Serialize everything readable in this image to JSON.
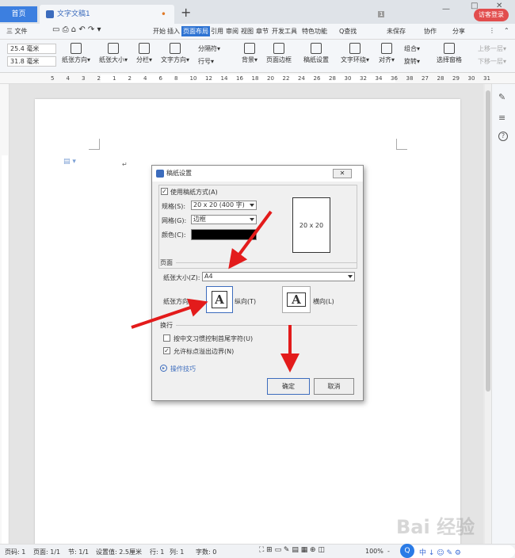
{
  "tabs": {
    "home": "首页",
    "doc": "文字文稿1",
    "doc_dot": "•",
    "new": "+"
  },
  "window": {
    "page_num": "1",
    "visitor": "访客登录",
    "min": "—",
    "max": "□",
    "close": "✕"
  },
  "menu": {
    "file": "三 文件",
    "items": [
      "开始",
      "插入",
      "页面布局",
      "引用",
      "审阅",
      "视图",
      "章节",
      "开发工具",
      "特色功能"
    ],
    "active": "页面布局",
    "search": "Q查找",
    "unsaved": "未保存",
    "coop": "协作",
    "share": "分享"
  },
  "ribbon": {
    "margin_top": "25.4 毫米",
    "margin_bottom": "31.8 毫米",
    "buttons": [
      "纸张方向",
      "纸张大小",
      "分栏",
      "文字方向",
      "分隔符",
      "行号",
      "背景",
      "页面边框",
      "稿纸设置",
      "文字环绕",
      "对齐",
      "组合",
      "旋转",
      "选择窗格",
      "上移一层",
      "下移一层"
    ]
  },
  "ruler": {
    "ticks": [
      "5",
      "4",
      "3",
      "2",
      "1",
      "2",
      "4",
      "6",
      "8",
      "10",
      "12",
      "14",
      "16",
      "18",
      "20",
      "22",
      "24",
      "26",
      "28",
      "30",
      "32",
      "34",
      "36",
      "38",
      "27",
      "28",
      "29",
      "30",
      "31"
    ]
  },
  "dialog": {
    "title": "稿纸设置",
    "close": "✕",
    "use_manuscript": "使用稿纸方式(A)",
    "spec_label": "规格(S):",
    "spec_value": "20 x 20 (400 字)",
    "grid_label": "网格(G):",
    "grid_value": "边框",
    "color_label": "颜色(C):",
    "color_value": "#000000",
    "preview": "20 x 20",
    "page_section": "页面",
    "paper_size_label": "纸张大小(Z):",
    "paper_size_value": "A4",
    "orientation_label": "纸张方向",
    "portrait": "纵向(T)",
    "landscape": "横向(L)",
    "letter_A": "A",
    "wrap_section": "换行",
    "opt1": "按中文习惯控制首尾字符(U)",
    "opt2": "允许标点溢出边界(N)",
    "tips": "操作技巧",
    "ok": "确定",
    "cancel": "取消"
  },
  "status": {
    "page": "页码: 1",
    "pages": "页面: 1/1",
    "section": "节: 1/1",
    "setting": "设置值: 2.5厘米",
    "row": "行: 1",
    "col": "列: 1",
    "words": "字数: 0",
    "zoom": "100%",
    "minus": "-"
  },
  "ime": {
    "text": "中 ↓ ☺ ✎ ⚙"
  },
  "watermark": "Bai 经验"
}
